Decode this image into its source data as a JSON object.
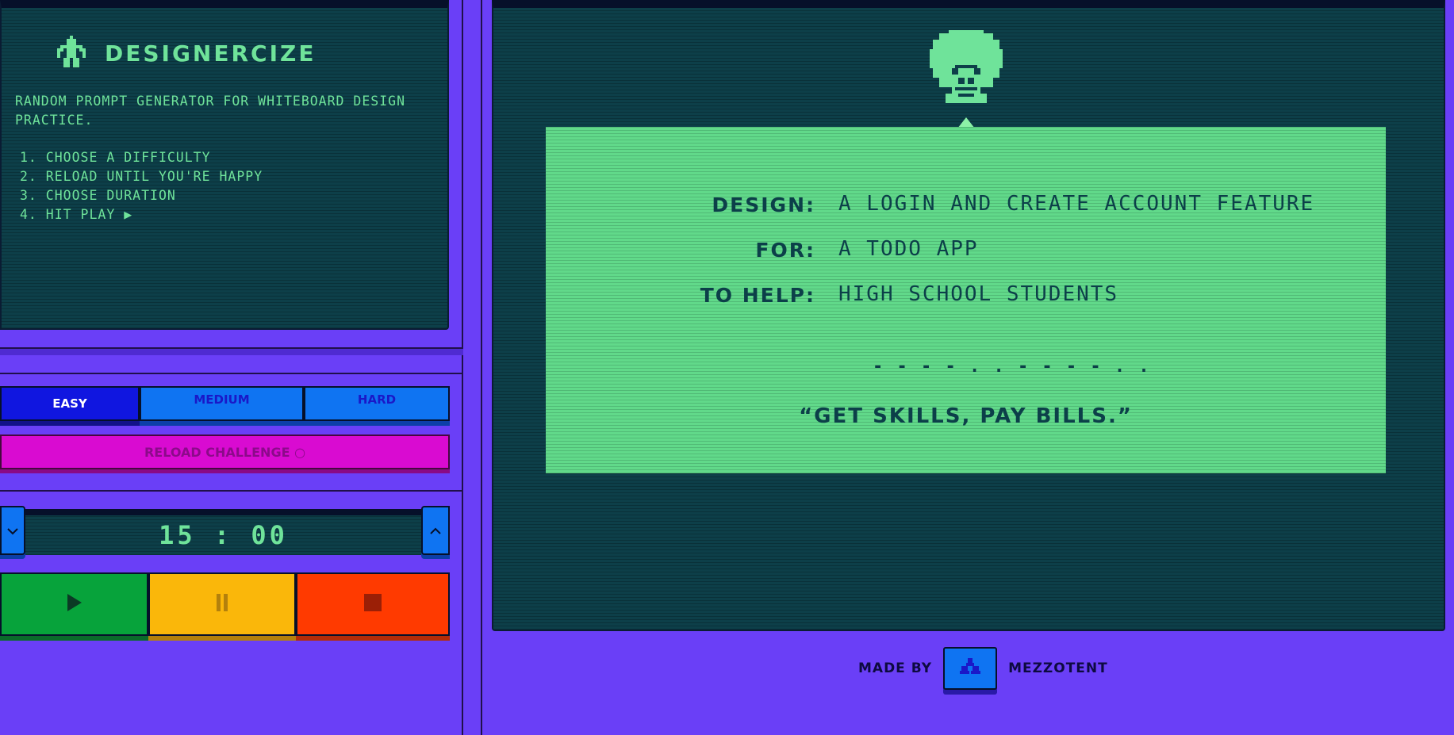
{
  "app": {
    "title": "DESIGNERCIZE",
    "tagline": "RANDOM PROMPT GENERATOR FOR WHITEBOARD DESIGN PRACTICE.",
    "steps": [
      "1. CHOOSE A DIFFICULTY",
      "2. RELOAD UNTIL YOU'RE HAPPY",
      "3. CHOOSE DURATION",
      "4. HIT PLAY ▶"
    ]
  },
  "difficulty": {
    "options": [
      "EASY",
      "MEDIUM",
      "HARD"
    ],
    "selected": "EASY"
  },
  "reload": {
    "label": "RELOAD CHALLENGE ○"
  },
  "timer": {
    "display": "15 : 00"
  },
  "prompt": {
    "design_label": "DESIGN:",
    "design_value": "A LOGIN AND CREATE ACCOUNT FEATURE",
    "for_label": "FOR:",
    "for_value": "A TODO APP",
    "to_help_label": "TO HELP:",
    "to_help_value": "HIGH SCHOOL STUDENTS",
    "morse": "- - - - . . - - - - . .",
    "quote": "“GET SKILLS, PAY BILLS.”"
  },
  "footer": {
    "made_by": "MADE BY",
    "author": "MEZZOTENT"
  },
  "colors": {
    "background": "#6a3ff7",
    "screen": "#0d3f49",
    "screen_text": "#6fe39a",
    "card": "#61d98a",
    "easy": "#1016e0",
    "medium_hard": "#0f74f2",
    "reload": "#d90bd1",
    "play": "#07a33b",
    "pause": "#fab70a",
    "stop": "#ff3a00"
  },
  "icons": {
    "logo": "robot-icon",
    "avatar": "pixel-avatar-icon",
    "badge": "cluster-icon"
  }
}
